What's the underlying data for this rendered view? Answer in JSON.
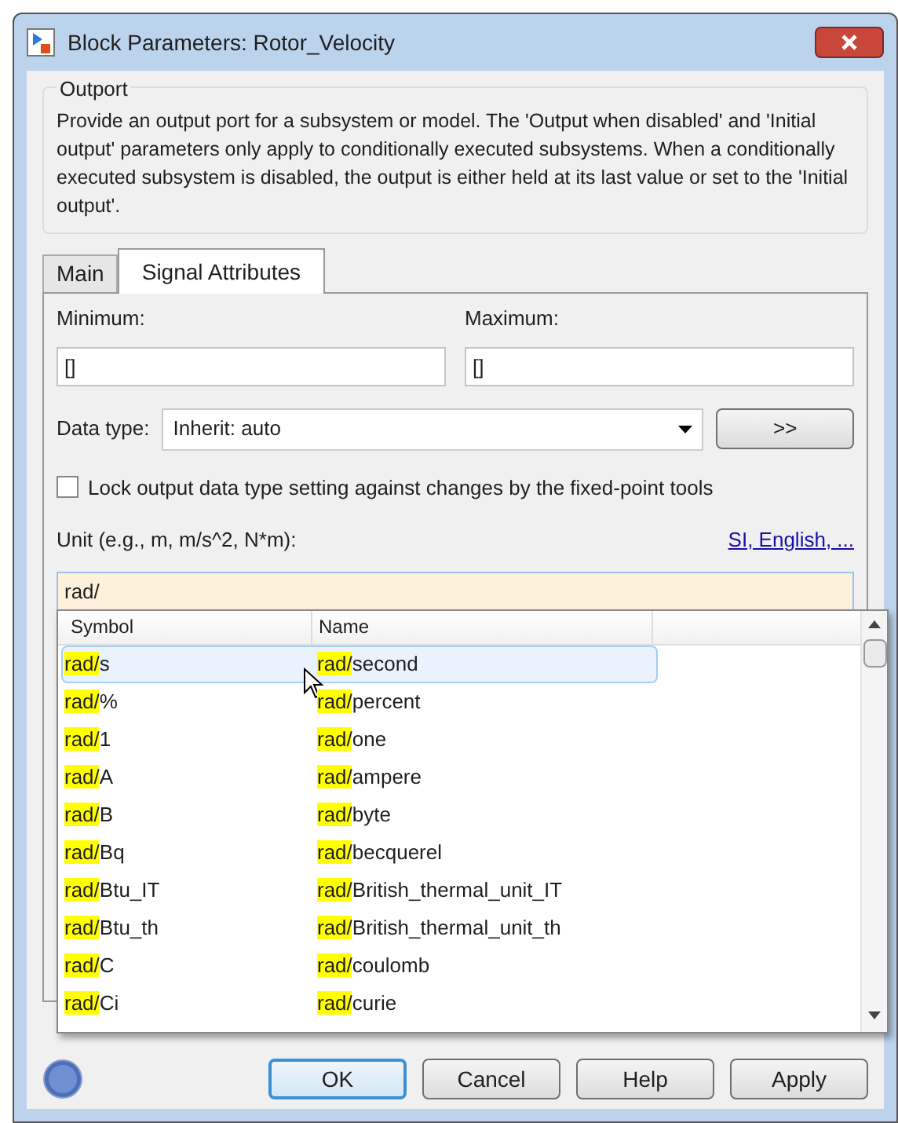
{
  "window": {
    "title": "Block Parameters: Rotor_Velocity"
  },
  "group": {
    "title": "Outport",
    "description": "Provide an output port for a subsystem or model.  The 'Output when disabled' and 'Initial output' parameters only apply to conditionally executed subsystems. When a conditionally executed subsystem is disabled, the output is either held at its last value or set to the 'Initial output'."
  },
  "tabs": [
    {
      "label": "Main",
      "selected": false
    },
    {
      "label": "Signal Attributes",
      "selected": true
    }
  ],
  "minimum": {
    "label": "Minimum:",
    "value": "[]"
  },
  "maximum": {
    "label": "Maximum:",
    "value": "[]"
  },
  "data_type": {
    "label": "Data type:",
    "value": "Inherit: auto",
    "button": ">>"
  },
  "lock_checkbox": {
    "label": "Lock output data type setting against changes by the fixed-point tools",
    "checked": false
  },
  "unit": {
    "label": "Unit (e.g., m, m/s^2, N*m):",
    "link": "SI, English, ...",
    "value": "rad/"
  },
  "suggestions": {
    "columns": [
      "Symbol",
      "Name"
    ],
    "rows": [
      {
        "symbol": "rad/s",
        "name": "rad/second",
        "selected": true
      },
      {
        "symbol": "rad/%",
        "name": "rad/percent",
        "selected": false
      },
      {
        "symbol": "rad/1",
        "name": "rad/one",
        "selected": false
      },
      {
        "symbol": "rad/A",
        "name": "rad/ampere",
        "selected": false
      },
      {
        "symbol": "rad/B",
        "name": "rad/byte",
        "selected": false
      },
      {
        "symbol": "rad/Bq",
        "name": "rad/becquerel",
        "selected": false
      },
      {
        "symbol": "rad/Btu_IT",
        "name": "rad/British_thermal_unit_IT",
        "selected": false
      },
      {
        "symbol": "rad/Btu_th",
        "name": "rad/British_thermal_unit_th",
        "selected": false
      },
      {
        "symbol": "rad/C",
        "name": "rad/coulomb",
        "selected": false
      },
      {
        "symbol": "rad/Ci",
        "name": "rad/curie",
        "selected": false
      }
    ]
  },
  "buttons": [
    {
      "label": "OK",
      "default": true
    },
    {
      "label": "Cancel",
      "default": false
    },
    {
      "label": "Help",
      "default": false
    },
    {
      "label": "Apply",
      "default": false
    }
  ]
}
